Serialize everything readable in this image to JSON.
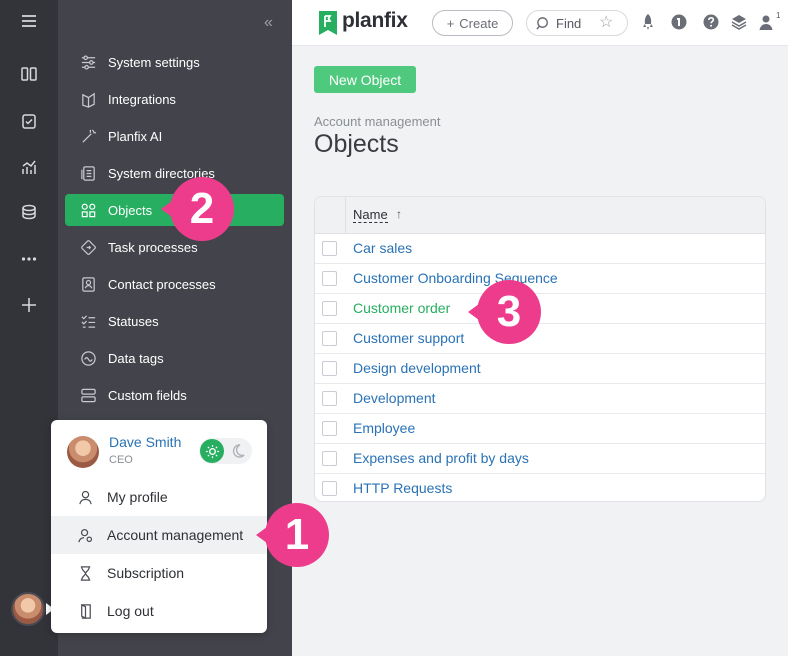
{
  "brand": {
    "name": "planfix",
    "accent": "#27ae60",
    "callout_color": "#ee3c8c"
  },
  "topbar": {
    "create_label": "Create",
    "find_placeholder": "Find",
    "badge": "1"
  },
  "sidebar": {
    "items": [
      {
        "label": "System settings",
        "icon": "sliders-icon"
      },
      {
        "label": "Integrations",
        "icon": "integrations-icon"
      },
      {
        "label": "Planfix AI",
        "icon": "magic-wand-icon"
      },
      {
        "label": "System directories",
        "icon": "directory-icon"
      },
      {
        "label": "Objects",
        "icon": "objects-icon"
      },
      {
        "label": "Task processes",
        "icon": "task-process-icon"
      },
      {
        "label": "Contact processes",
        "icon": "contact-process-icon"
      },
      {
        "label": "Statuses",
        "icon": "statuses-icon"
      },
      {
        "label": "Data tags",
        "icon": "data-tags-icon"
      },
      {
        "label": "Custom fields",
        "icon": "custom-fields-icon"
      }
    ]
  },
  "main": {
    "new_button": "New Object",
    "breadcrumb": "Account management",
    "title": "Objects",
    "table": {
      "column": "Name",
      "sort_indicator": "↑",
      "rows": [
        "Car sales",
        "Customer Onboarding Sequence",
        "Customer order",
        "Customer support",
        "Design development",
        "Development",
        "Employee",
        "Expenses and profit by days",
        "HTTP Requests"
      ]
    }
  },
  "user_menu": {
    "name": "Dave Smith",
    "role": "CEO",
    "items": [
      "My profile",
      "Account management",
      "Subscription",
      "Log out"
    ]
  },
  "callouts": [
    "1",
    "2",
    "3"
  ]
}
